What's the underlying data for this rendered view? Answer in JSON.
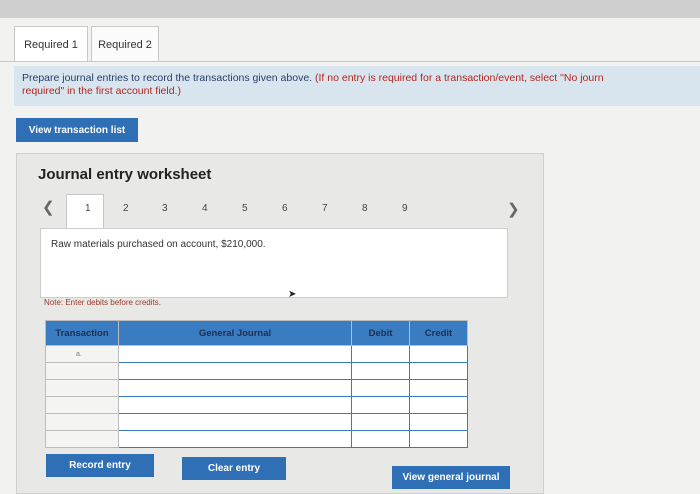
{
  "tabs": [
    {
      "label": "Required 1"
    },
    {
      "label": "Required 2"
    }
  ],
  "instructions": {
    "main": "Prepare journal entries to record the transactions given above.",
    "paren_line1": "(If no entry is required for a transaction/event, select \"No journ",
    "paren_line2": "required\" in the first account field.)"
  },
  "buttons": {
    "view_transaction_list": "View transaction list",
    "record_entry": "Record entry",
    "clear_entry": "Clear entry",
    "view_general_journal": "View general journal"
  },
  "worksheet": {
    "title": "Journal entry worksheet",
    "pages": [
      "1",
      "2",
      "3",
      "4",
      "5",
      "6",
      "7",
      "8",
      "9"
    ],
    "description": "Raw materials purchased on account, $210,000.",
    "note": "Note: Enter debits before credits."
  },
  "journal_table": {
    "headers": {
      "transaction": "Transaction",
      "general_journal": "General Journal",
      "debit": "Debit",
      "credit": "Credit"
    },
    "first_transaction": "a."
  },
  "colors": {
    "accent": "#2e6fb5",
    "instructions_bg": "#d8e5ee",
    "note": "#9a3a2a"
  }
}
